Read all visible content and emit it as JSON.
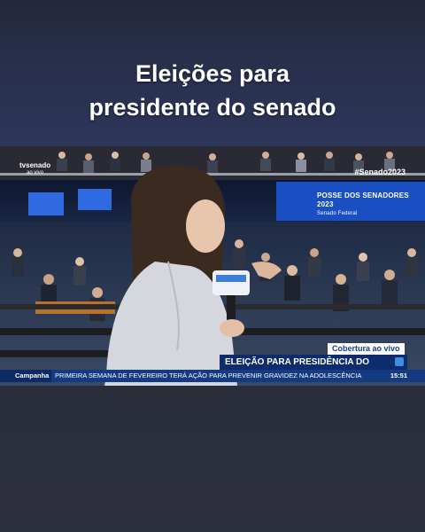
{
  "headline": {
    "line1": "Eleições para",
    "line2": "presidente do senado"
  },
  "broadcast": {
    "logo_name": "tvsenado",
    "logo_sub": "ao vivo",
    "hashtag": "#Senado2023",
    "screen_title": "POSSE DOS SENADORES 2023",
    "screen_subtitle": "Senado Federal",
    "live_badge": "Cobertura ao vivo",
    "lower_third_title": "ELEIÇÃO PARA PRESIDÊNCIA DO SENADO",
    "ticker_label": "Campanha",
    "ticker_text": "PRIMEIRA SEMANA DE FEVEREIRO TERÁ AÇÃO PARA PREVENIR GRAVIDEZ NA ADOLESCÊNCIA",
    "ticker_time": "15:51"
  },
  "colors": {
    "page_background": "#2b2e3b",
    "lower_third": "#0c2c6e",
    "ticker": "#143a82",
    "screen_blue": "#1a4fc4"
  }
}
